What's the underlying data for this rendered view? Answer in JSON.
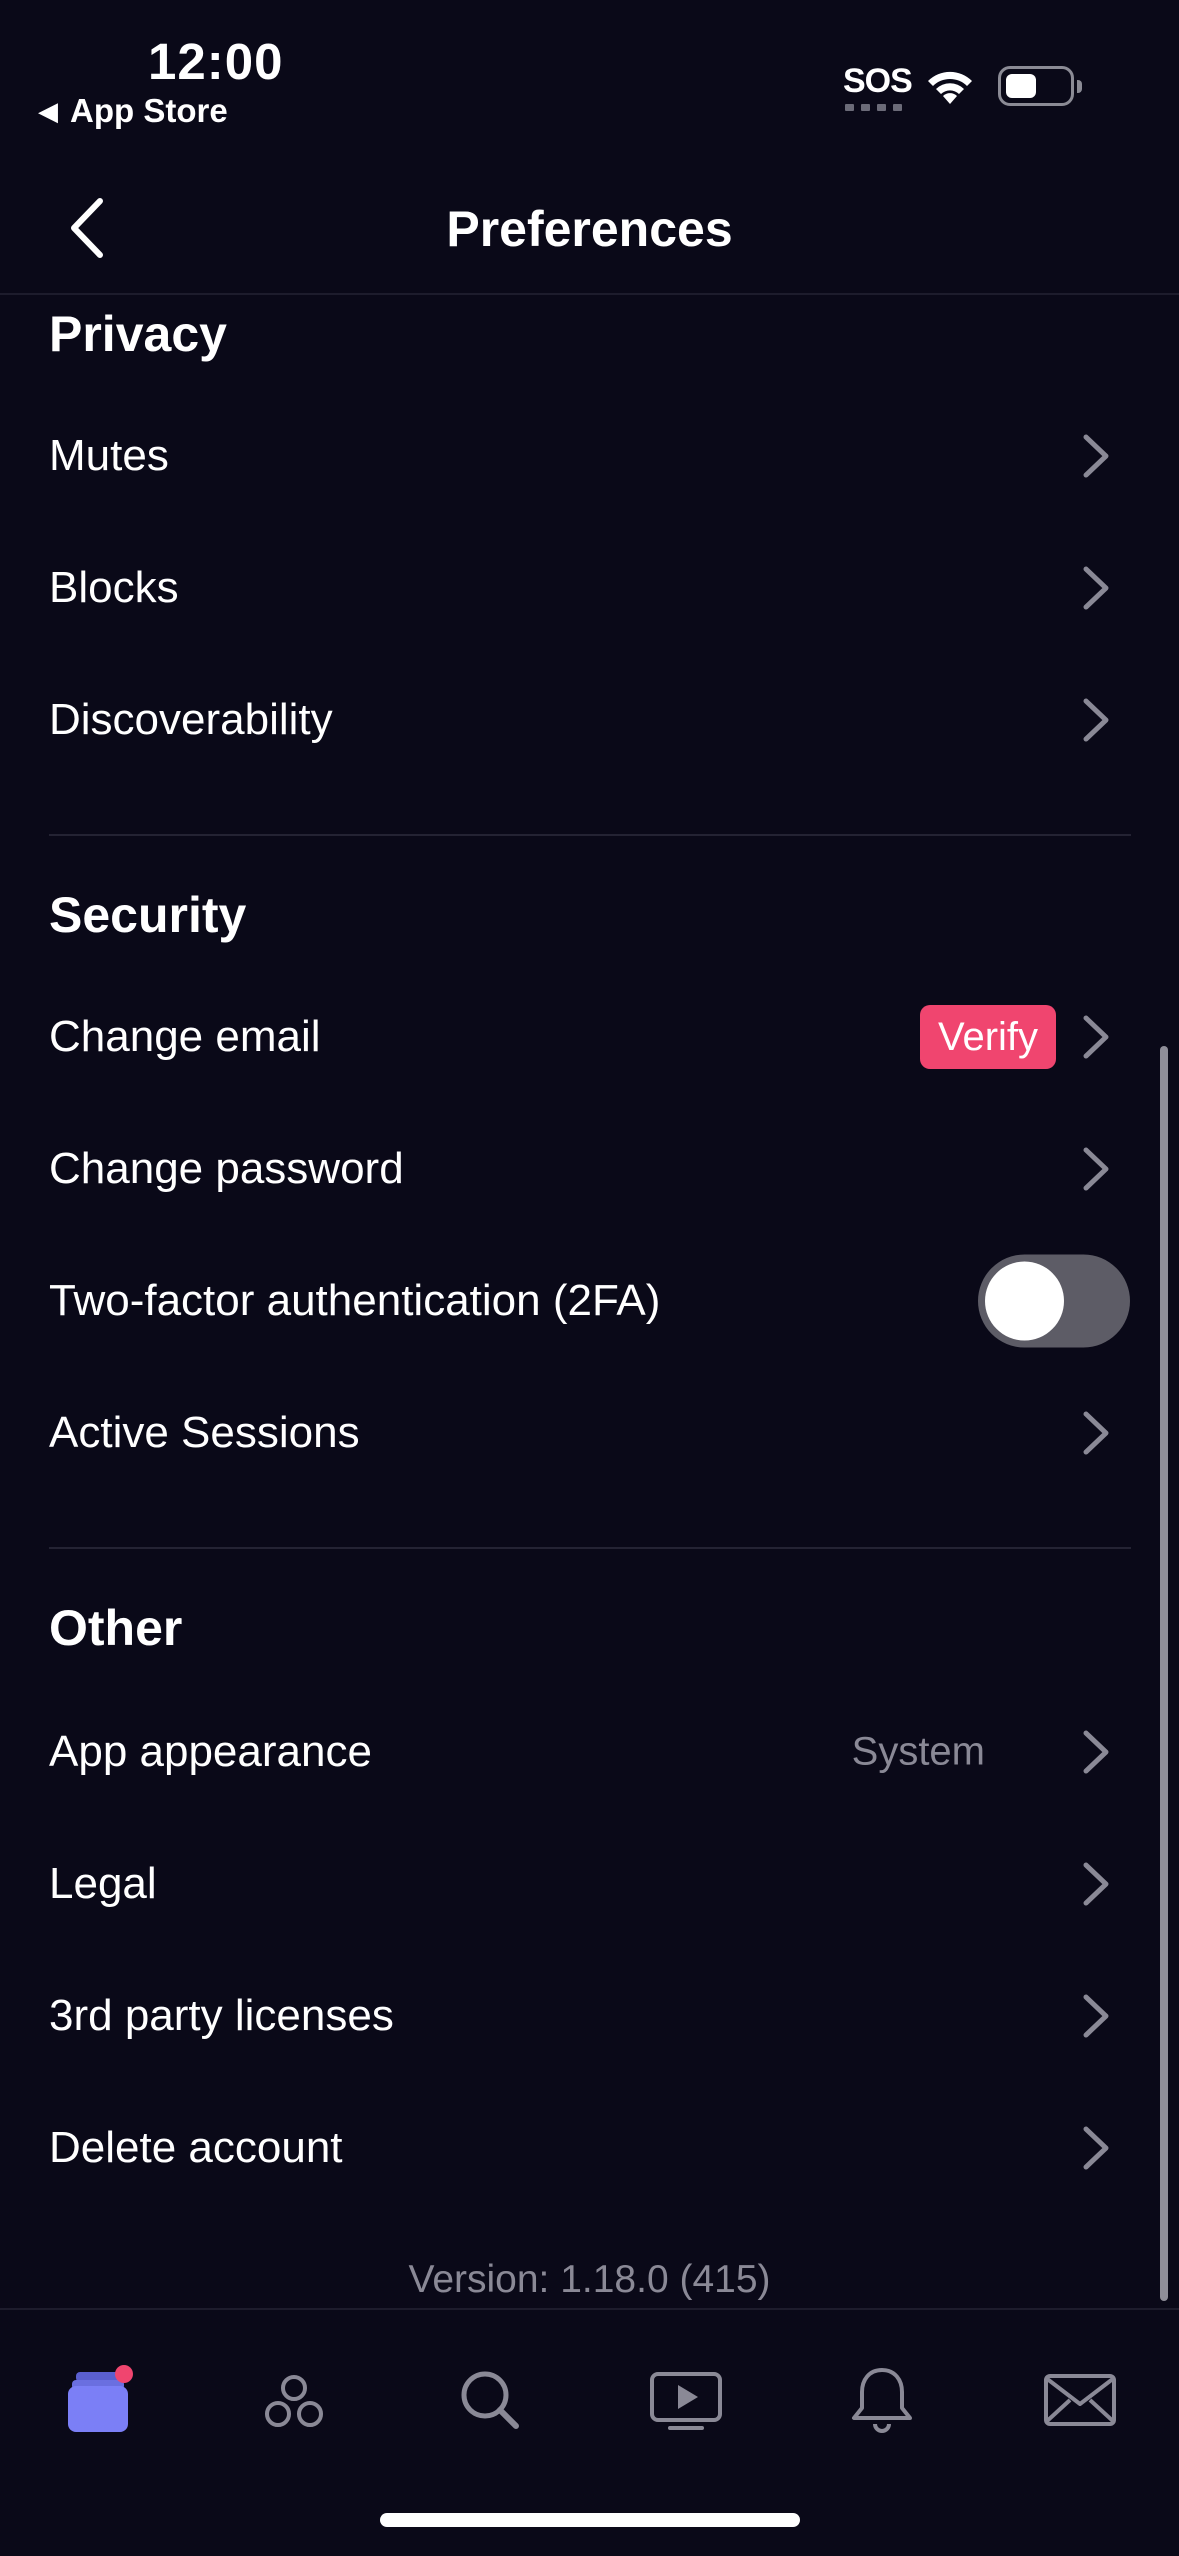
{
  "status_bar": {
    "time": "12:00",
    "back_app": "App Store",
    "sos": "SOS"
  },
  "nav": {
    "title": "Preferences"
  },
  "sections": {
    "privacy": {
      "title": "Privacy",
      "items": [
        "Mutes",
        "Blocks",
        "Discoverability"
      ]
    },
    "security": {
      "title": "Security",
      "change_email": "Change email",
      "verify_badge": "Verify",
      "change_password": "Change password",
      "two_factor": "Two-factor authentication (2FA)",
      "two_factor_enabled": false,
      "active_sessions": "Active Sessions"
    },
    "other": {
      "title": "Other",
      "app_appearance": "App appearance",
      "app_appearance_value": "System",
      "legal": "Legal",
      "licenses": "3rd party licenses",
      "delete_account": "Delete account"
    }
  },
  "version": "Version: 1.18.0 (415)",
  "tabbar": {
    "items": [
      "feeds-icon",
      "communities-icon",
      "search-icon",
      "video-icon",
      "notifications-icon",
      "messages-icon"
    ],
    "feeds_has_badge": true
  },
  "colors": {
    "background": "#0a0918",
    "accent": "#f0456f",
    "tab_active": "#7b7ff6",
    "muted_text": "#8a8996"
  }
}
